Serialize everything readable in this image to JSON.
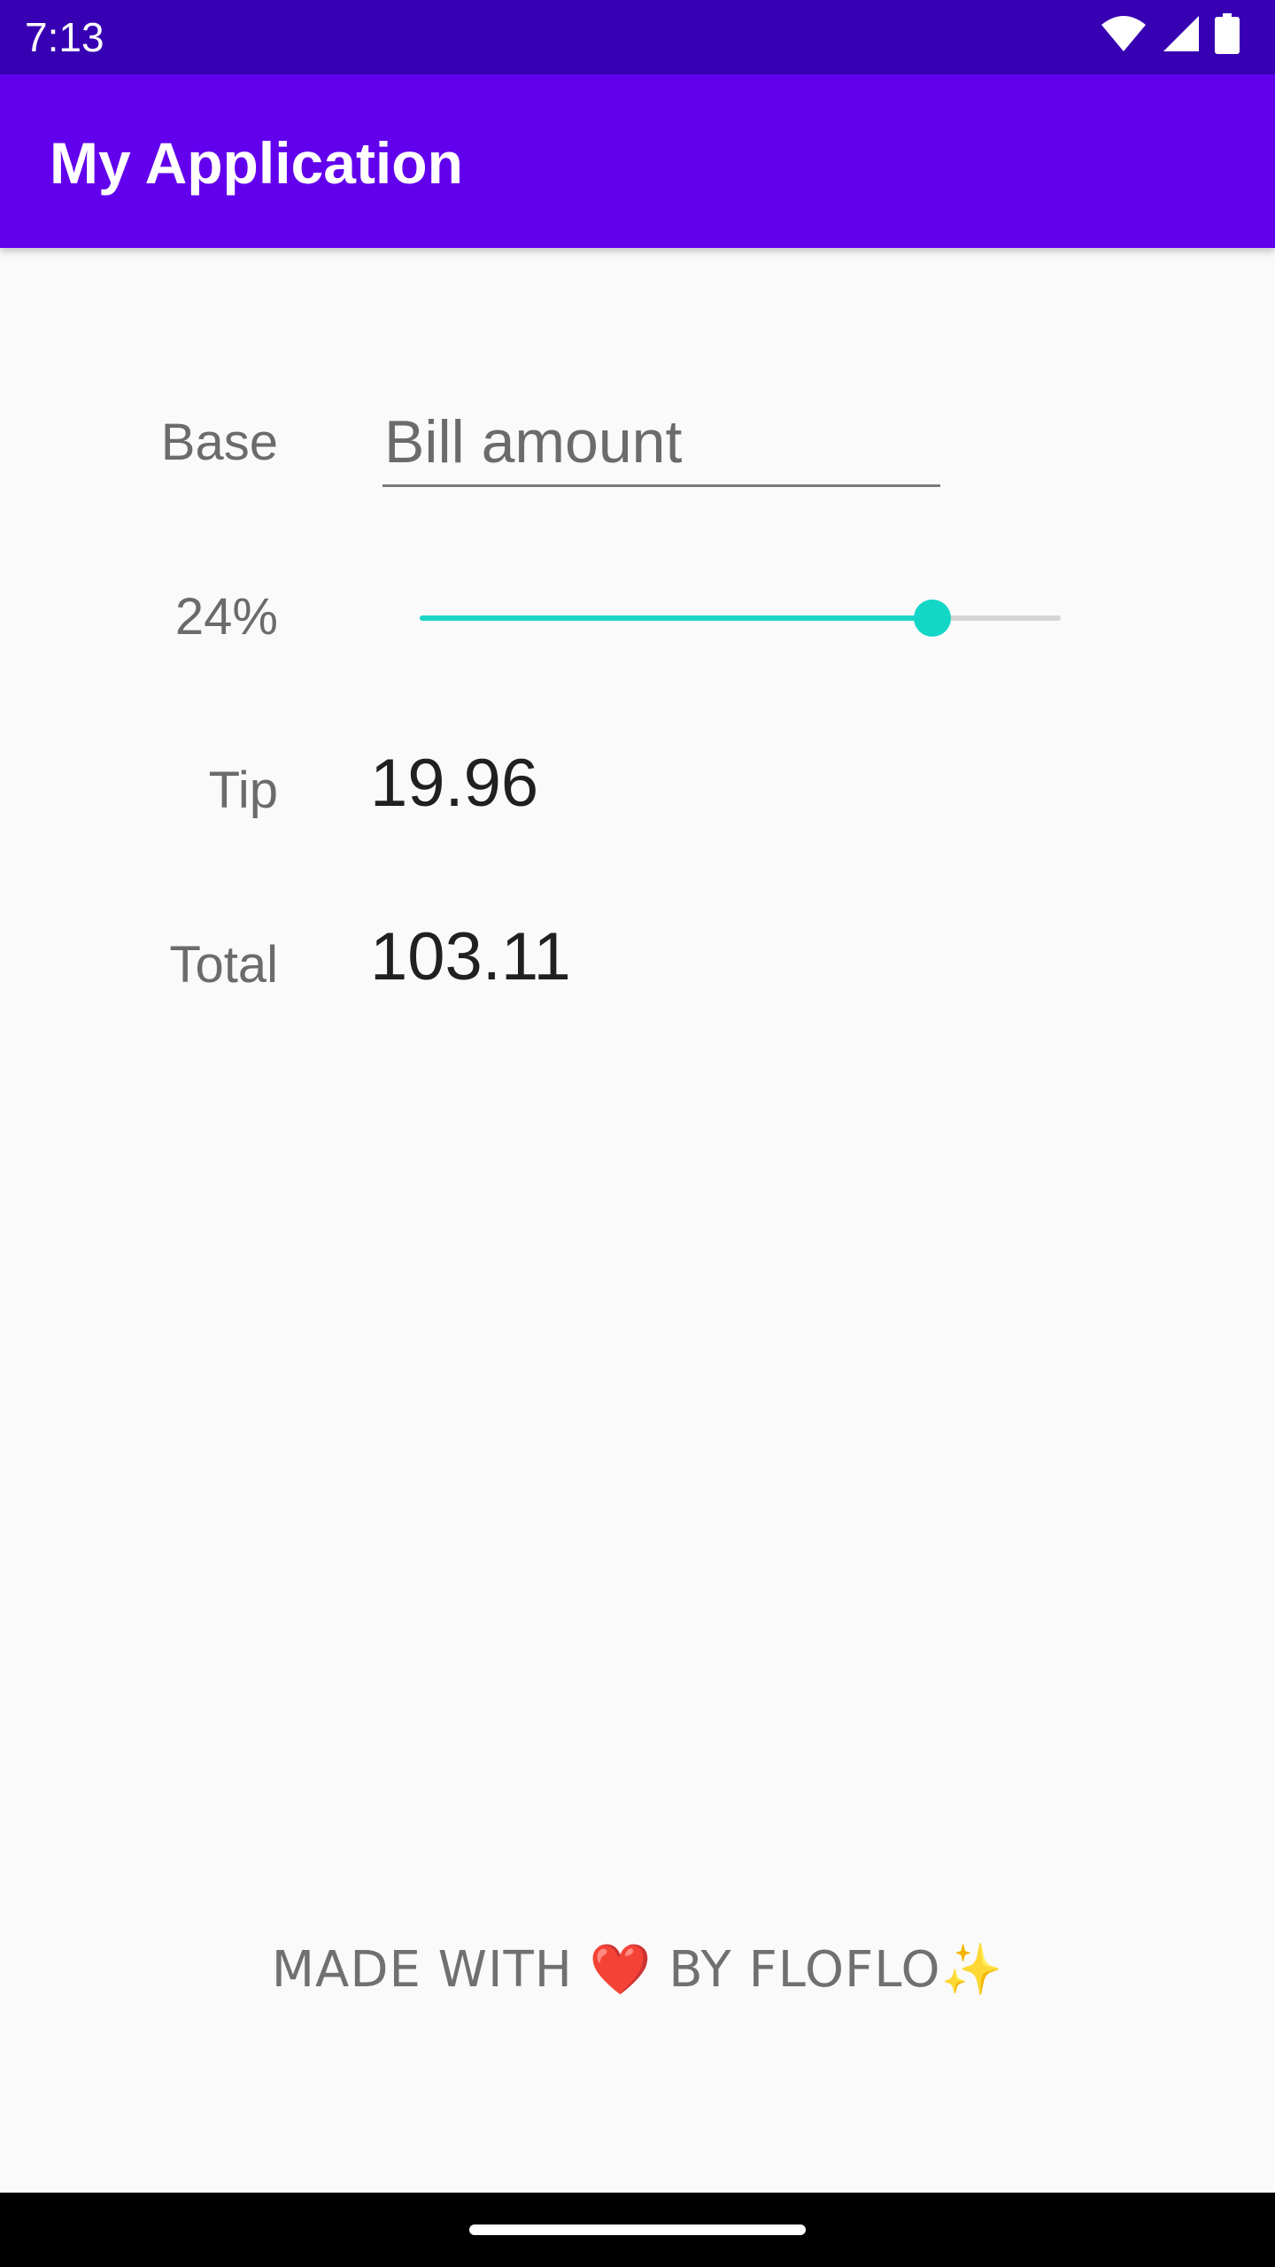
{
  "status_bar": {
    "time": "7:13",
    "icons": [
      "wifi-icon",
      "cell-signal-icon",
      "battery-icon"
    ],
    "background": "#3700b3"
  },
  "app_bar": {
    "title": "My Application",
    "background": "#6200ee"
  },
  "form": {
    "base_label": "Base",
    "bill_input": {
      "value": "",
      "placeholder": "Bill amount"
    },
    "tip_percent_label": "24%",
    "tip_slider": {
      "value_fraction": 0.8,
      "accent_color": "#1ed6c8"
    },
    "tip_label": "Tip",
    "tip_value": "19.96",
    "total_label": "Total",
    "total_value": "103.11"
  },
  "footer": {
    "prefix": "MADE WITH",
    "heart": "❤️",
    "middle": "BY FLOFLO",
    "sparkle": "✨"
  }
}
